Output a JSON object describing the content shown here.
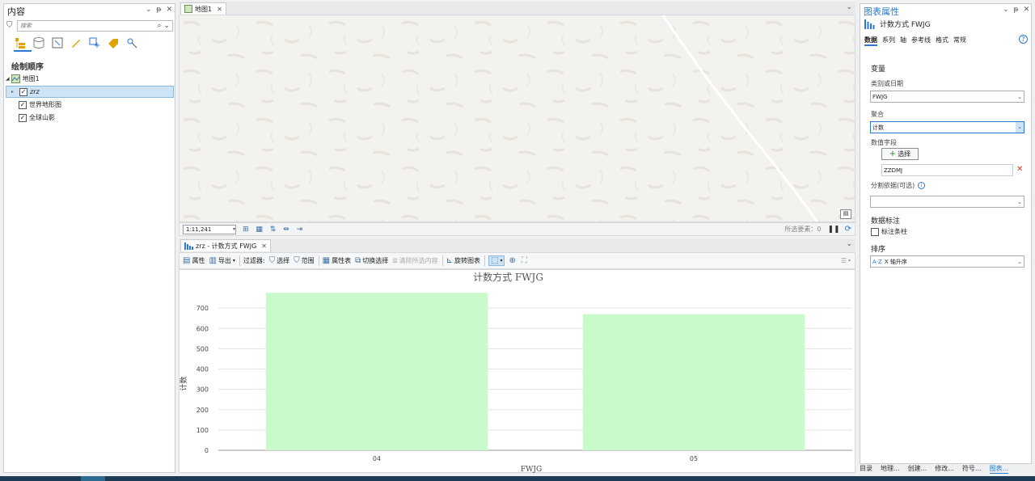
{
  "contents_pane": {
    "title": "内容",
    "search_placeholder": "搜索",
    "section_title": "绘制顺序",
    "map_node": "地图1",
    "layers": [
      {
        "name": "zrz",
        "checked": true,
        "selected": true
      },
      {
        "name": "世界地形图",
        "checked": true,
        "selected": false
      },
      {
        "name": "全球山影",
        "checked": true,
        "selected": false
      }
    ]
  },
  "map_view": {
    "tab_label": "地图1",
    "scale": "1:11,241",
    "status_text": "所选要素：0"
  },
  "chart_view": {
    "tab_label": "zrz - 计数方式 FWJG",
    "toolbar": {
      "properties": "属性",
      "export": "导出",
      "filter": "过滤器:",
      "select": "选择",
      "extent": "范围",
      "attribute_table": "属性表",
      "switch_selection": "切换选择",
      "clear_selection": "清除所选内容",
      "rotate_chart": "旋转图表"
    }
  },
  "chart_data": {
    "type": "bar",
    "title": "计数方式 FWJG",
    "xlabel": "FWJG",
    "ylabel": "计数",
    "categories": [
      "04",
      "05"
    ],
    "values": [
      775,
      670
    ],
    "ylim": [
      0,
      800
    ],
    "yticks": [
      0,
      100,
      200,
      300,
      400,
      500,
      600,
      700
    ],
    "bar_color": "#c8facc",
    "grid": true
  },
  "properties_pane": {
    "title": "图表属性",
    "chart_name": "计数方式 FWJG",
    "tabs": [
      "数据",
      "系列",
      "轴",
      "参考线",
      "格式",
      "常规"
    ],
    "active_tab": "数据",
    "variables_heading": "变量",
    "category_label": "类别或日期",
    "category_value": "FWJG",
    "aggregation_label": "聚合",
    "aggregation_value": "计数",
    "numeric_fields_label": "数值字段",
    "select_button": "选择",
    "numeric_field_value": "ZZDMJ",
    "split_label": "分割依据(可选)",
    "split_value": "",
    "labels_heading": "数据标注",
    "label_bars": "标注条柱",
    "sort_heading": "排序",
    "sort_value": "X 轴升序"
  },
  "bottom_tabs": [
    "目录",
    "地理...",
    "创建...",
    "修改...",
    "符号...",
    "图表..."
  ],
  "colors": {
    "accent": "#2b79d0",
    "selection": "#cde3f6",
    "map_bg": "#f4f2ee"
  }
}
